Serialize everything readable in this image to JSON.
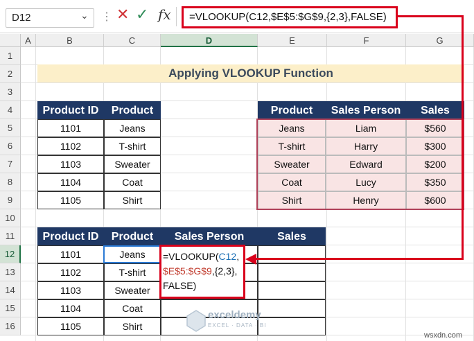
{
  "formula_bar": {
    "name_box": "D12",
    "formula": "=VLOOKUP(C12,$E$5:$G$9,{2,3},FALSE)"
  },
  "columns": [
    "A",
    "B",
    "C",
    "D",
    "E",
    "F",
    "G"
  ],
  "rows": [
    "1",
    "2",
    "3",
    "4",
    "5",
    "6",
    "7",
    "8",
    "9",
    "10",
    "11",
    "12",
    "13",
    "14",
    "15",
    "16"
  ],
  "title": "Applying VLOOKUP Function",
  "table1": {
    "headers": [
      "Product ID",
      "Product"
    ],
    "rows": [
      [
        "1101",
        "Jeans"
      ],
      [
        "1102",
        "T-shirt"
      ],
      [
        "1103",
        "Sweater"
      ],
      [
        "1104",
        "Coat"
      ],
      [
        "1105",
        "Shirt"
      ]
    ]
  },
  "table2": {
    "headers": [
      "Product",
      "Sales Person",
      "Sales"
    ],
    "rows": [
      [
        "Jeans",
        "Liam",
        "$560"
      ],
      [
        "T-shirt",
        "Harry",
        "$300"
      ],
      [
        "Sweater",
        "Edward",
        "$200"
      ],
      [
        "Coat",
        "Lucy",
        "$350"
      ],
      [
        "Shirt",
        "Henry",
        "$600"
      ]
    ]
  },
  "table3": {
    "headers": [
      "Product ID",
      "Product",
      "Sales Person",
      "Sales"
    ],
    "rows": [
      [
        "1101",
        "Jeans",
        "",
        ""
      ],
      [
        "1102",
        "T-shirt",
        "",
        ""
      ],
      [
        "1103",
        "Sweater",
        "",
        ""
      ],
      [
        "1104",
        "Coat",
        "",
        ""
      ],
      [
        "1105",
        "Shirt",
        "",
        ""
      ]
    ]
  },
  "cell_formula": {
    "line1_a": "=VLOOKUP(",
    "line1_b": "C12",
    "line1_c": ",",
    "line2_a": "$E$5:$G$9",
    "line2_b": ",{2,3},",
    "line3": "FALSE)"
  },
  "watermark": {
    "logo_name": "exceldemy",
    "logo_tag": "EXCEL · DATA · BI",
    "site": "wsxdn.com"
  },
  "colors": {
    "header_fill": "#1f3864",
    "title_fill": "#fcefc9",
    "highlight_red": "#d9001b",
    "pink_fill": "#f9e4e4"
  }
}
